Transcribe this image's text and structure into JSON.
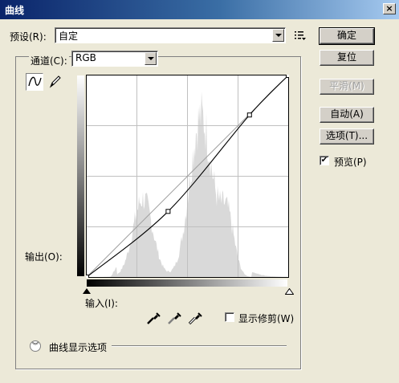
{
  "window": {
    "title": "曲线"
  },
  "preset": {
    "label": "预设(R):",
    "value": "自定"
  },
  "channel": {
    "label": "通道(C):",
    "value": "RGB"
  },
  "buttons": {
    "ok": "确定",
    "reset": "复位",
    "smooth": "平滑(M)",
    "auto": "自动(A)",
    "options": "选项(T)..."
  },
  "preview": {
    "label": "预览(P)",
    "checked": true
  },
  "graph": {
    "output_label": "输出(O):",
    "input_label": "输入(I):",
    "curve_points": [
      {
        "input": 0,
        "output": 0
      },
      {
        "input": 103,
        "output": 83
      },
      {
        "input": 206,
        "output": 205
      },
      {
        "input": 255,
        "output": 255
      }
    ]
  },
  "show_clipping": {
    "label": "显示修剪(W)",
    "checked": false
  },
  "curve_display_options": {
    "label": "曲线显示选项"
  },
  "icons": {
    "close": "close-icon",
    "preset_menu": "preset-options-icon",
    "curve_tool": "curve-icon",
    "pencil_tool": "pencil-icon",
    "black_point": "black-eyedropper-icon",
    "gray_point": "gray-eyedropper-icon",
    "white_point": "white-eyedropper-icon",
    "expand": "chevron-down-icon"
  }
}
